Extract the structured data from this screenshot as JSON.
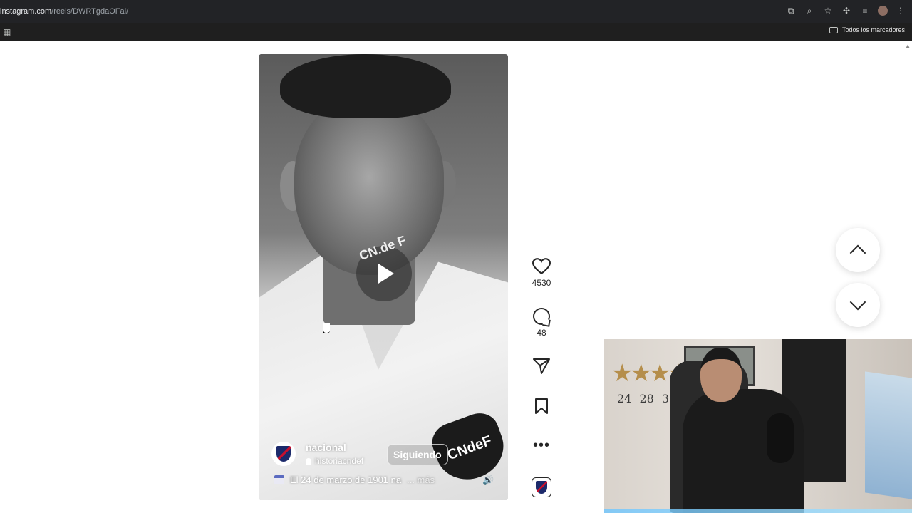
{
  "browser": {
    "url_host": "instagram.com",
    "url_path": "/reels/DWRTgdaOFai/",
    "bookmarks_all": "Todos los marcadores"
  },
  "reel": {
    "account_name": "nacional",
    "collab_account": "historiacndef",
    "follow_label": "Siguiendo",
    "caption": "El 24 de marzo de 1901 na",
    "more_label": "... más",
    "shirt_badge_text": "CNdeF",
    "overlay_logo_text": "CN.de F"
  },
  "actions": {
    "likes": "4530",
    "comments": "48"
  },
  "webcam": {
    "stars": "★★★★",
    "years": "24 28 30 50"
  }
}
